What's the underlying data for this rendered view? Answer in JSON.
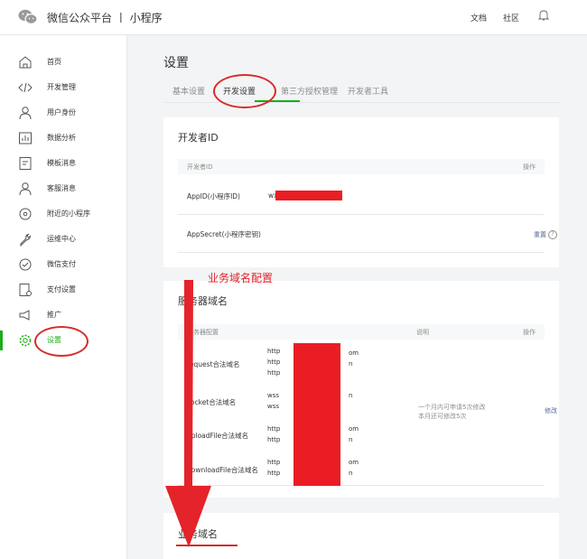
{
  "topbar": {
    "app_title": "微信公众平台 丨 小程序",
    "doc_link": "文档",
    "community_link": "社区"
  },
  "sidebar": {
    "items": [
      {
        "label": "首页",
        "icon": "home-icon"
      },
      {
        "label": "开发管理",
        "icon": "code-icon"
      },
      {
        "label": "用户身份",
        "icon": "user-icon"
      },
      {
        "label": "数据分析",
        "icon": "bar-chart-icon"
      },
      {
        "label": "模板消息",
        "icon": "template-icon"
      },
      {
        "label": "客服消息",
        "icon": "customer-service-icon"
      },
      {
        "label": "附近的小程序",
        "icon": "location-icon"
      },
      {
        "label": "运维中心",
        "icon": "wrench-icon"
      },
      {
        "label": "微信支付",
        "icon": "wechat-pay-icon"
      },
      {
        "label": "支付设置",
        "icon": "payment-settings-icon"
      },
      {
        "label": "推广",
        "icon": "promotion-icon"
      },
      {
        "label": "设置",
        "icon": "gear-icon"
      }
    ],
    "active": "设置",
    "accent": "#1aad19"
  },
  "main": {
    "page_title": "设置",
    "tabs": [
      {
        "label": "基本设置"
      },
      {
        "label": "开发设置"
      },
      {
        "label": "第三方授权管理"
      },
      {
        "label": "开发者工具"
      }
    ],
    "active_tab": "开发设置",
    "developer_id": {
      "title": "开发者ID",
      "col_id": "开发者ID",
      "col_action": "操作",
      "rows": [
        {
          "label": "AppID(小程序ID)",
          "value": "wx"
        },
        {
          "label": "AppSecret(小程序密钥)",
          "action": "重置",
          "help": "?"
        }
      ]
    },
    "server_domain": {
      "title": "服务器域名",
      "col_config": "服务器配置",
      "col_desc": "说明",
      "col_action": "操作",
      "rows": [
        {
          "label": "request合法域名",
          "prefixes": [
            "http",
            "http",
            "http"
          ],
          "suffixes": [
            "om",
            "n"
          ]
        },
        {
          "label": "socket合法域名",
          "prefixes": [
            "wss",
            "wss"
          ],
          "suffixes": [
            "n"
          ]
        },
        {
          "label": "uploadFile合法域名",
          "prefixes": [
            "http",
            "http"
          ],
          "suffixes": [
            "om",
            "n"
          ]
        },
        {
          "label": "downloadFile合法域名",
          "prefixes": [
            "http",
            "http"
          ],
          "suffixes": [
            "om",
            "n"
          ]
        }
      ],
      "desc_line1": "一个月内可申请5次修改",
      "desc_line2": "本月还可修改5次",
      "modify": "修改"
    },
    "business_domain": {
      "title": "业务域名"
    }
  },
  "annotation": {
    "text": "业务域名配置",
    "color": "#e5232a"
  }
}
